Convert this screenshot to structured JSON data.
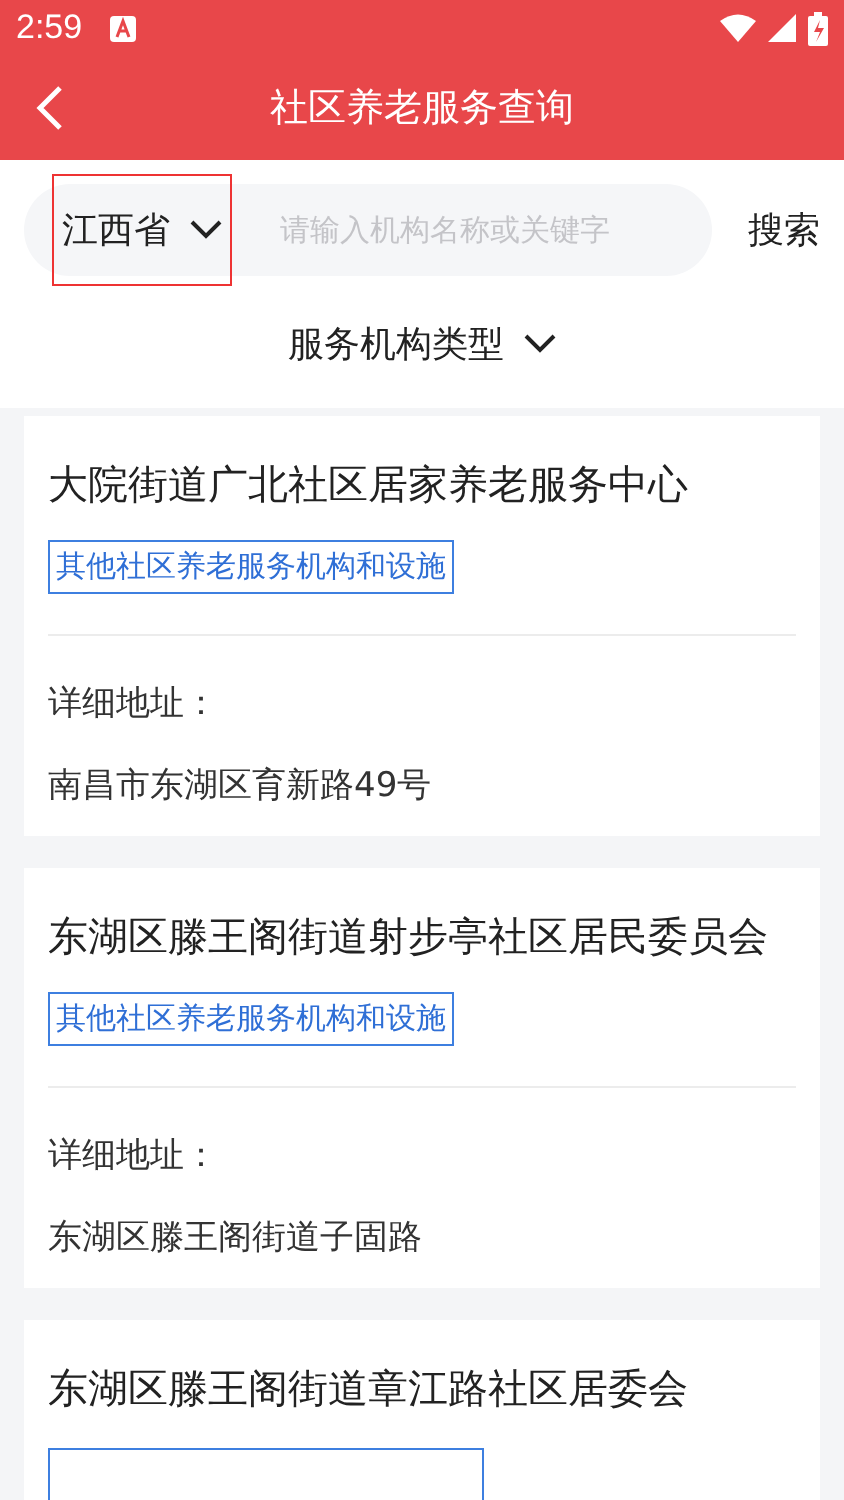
{
  "status_bar": {
    "time": "2:59"
  },
  "header": {
    "title": "社区养老服务查询"
  },
  "search": {
    "province": "江西省",
    "placeholder": "请输入机构名称或关键字",
    "button": "搜索"
  },
  "filter": {
    "label": "服务机构类型"
  },
  "cards": [
    {
      "title": "大院街道广北社区居家养老服务中心",
      "tag": "其他社区养老服务机构和设施",
      "address_label": "详细地址：",
      "address": "南昌市东湖区育新路49号"
    },
    {
      "title": "东湖区滕王阁街道射步亭社区居民委员会",
      "tag": "其他社区养老服务机构和设施",
      "address_label": "详细地址：",
      "address": "东湖区滕王阁街道子固路"
    },
    {
      "title": "东湖区滕王阁街道章江路社区居委会"
    }
  ]
}
